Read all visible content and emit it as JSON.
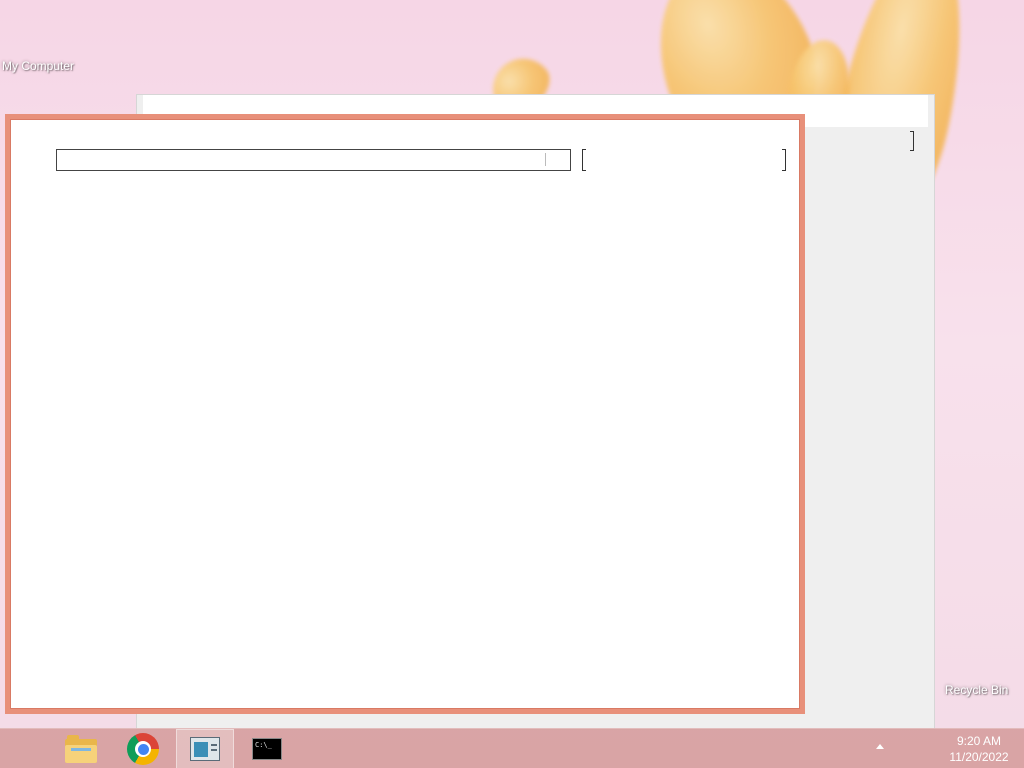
{
  "desktop": {
    "icons": [
      {
        "label": "My Computer"
      },
      {
        "label": "Recycle Bin"
      }
    ]
  },
  "dialog": {
    "text_field_value": ""
  },
  "taskbar": {
    "items": [
      {
        "icon": "file-explorer-icon",
        "label": "File Explorer",
        "active": false
      },
      {
        "icon": "chrome-icon",
        "label": "Google Chrome",
        "active": false
      },
      {
        "icon": "app-window-icon",
        "label": "Application",
        "active": true
      },
      {
        "icon": "command-prompt-icon",
        "label": "Command Prompt",
        "active": false
      }
    ],
    "cmd_glyph": "C:\\_",
    "clock": {
      "time": "9:20 AM",
      "date": "11/20/2022"
    }
  },
  "colors": {
    "dialog_border": "#e8907a",
    "taskbar": "#d6a0a0",
    "wallpaper_petal": "#f7c56e"
  }
}
